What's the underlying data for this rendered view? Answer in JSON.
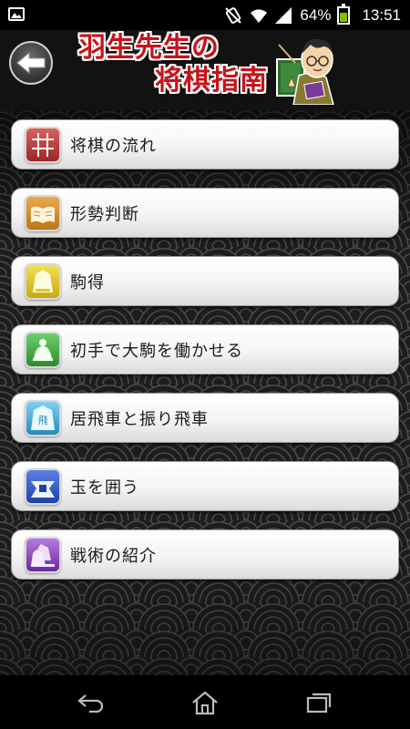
{
  "status_bar": {
    "battery_percent": "64%",
    "time": "13:51"
  },
  "header": {
    "title_line1": "羽生先生の",
    "title_line2": "将棋指南"
  },
  "menu": {
    "items": [
      {
        "label": "将棋の流れ",
        "icon": "shogi-board-icon",
        "color": "#b83a3a"
      },
      {
        "label": "形勢判断",
        "icon": "open-book-icon",
        "color": "#d08b28"
      },
      {
        "label": "駒得",
        "icon": "shogi-piece-icon",
        "color": "#e2c81f"
      },
      {
        "label": "初手で大駒を働かせる",
        "icon": "pawn-piece-icon",
        "color": "#3fae3f"
      },
      {
        "label": "居飛車と振り飛車",
        "icon": "rook-piece-icon",
        "color": "#3aa6d6"
      },
      {
        "label": "玉を囲う",
        "icon": "castle-king-icon",
        "color": "#2e55c9"
      },
      {
        "label": "戦術の紹介",
        "icon": "tactics-icon",
        "color": "#8a3fbf"
      }
    ]
  }
}
